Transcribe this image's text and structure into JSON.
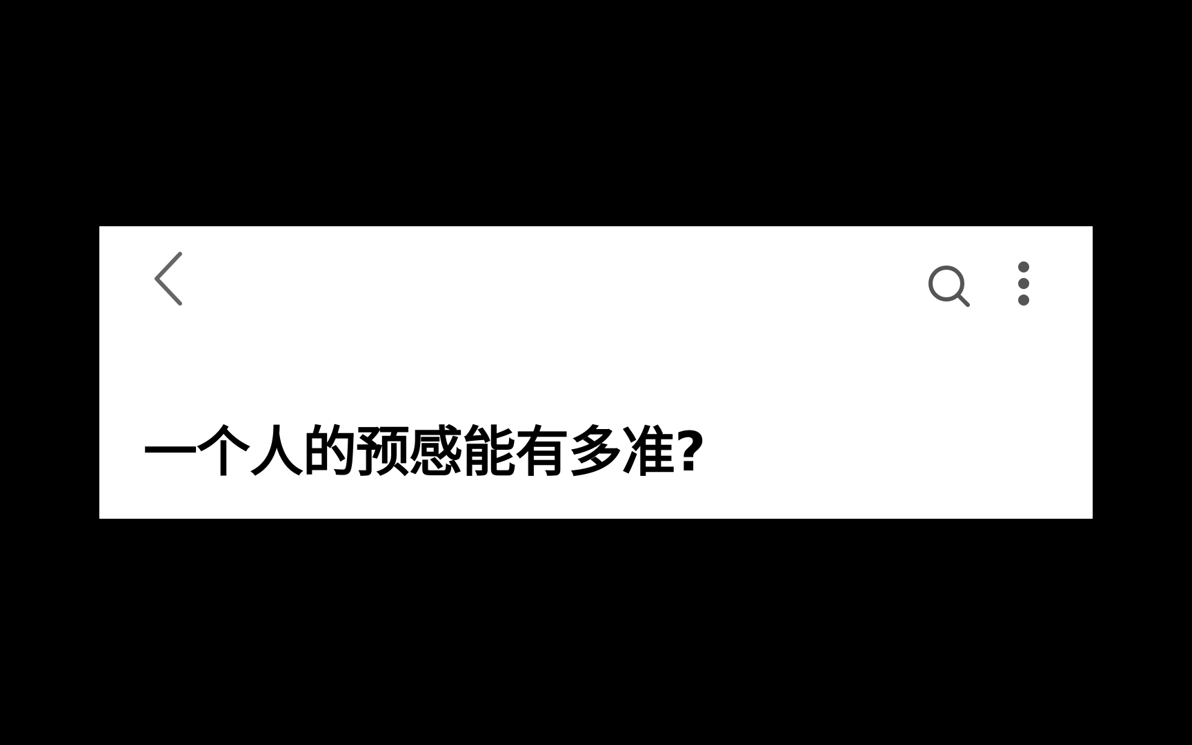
{
  "page": {
    "background_color": "#000000",
    "card_color": "#ffffff"
  },
  "topbar": {
    "back_icon": "chevron-left-icon",
    "search_icon": "search-icon",
    "more_icon": "more-vertical-icon",
    "icon_color": "#666666"
  },
  "question": {
    "title": "一个人的预感能有多准?"
  }
}
